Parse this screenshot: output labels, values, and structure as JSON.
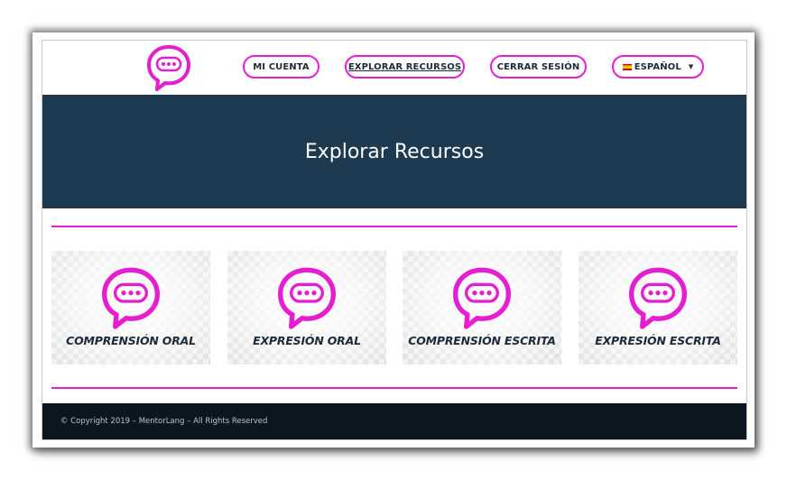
{
  "nav": {
    "my_account": "MI CUENTA",
    "explore": "EXPLORAR RECURSOS",
    "logout": "CERRAR SESIÓN",
    "language": "ESPAÑOL"
  },
  "hero": {
    "title": "Explorar Recursos"
  },
  "cards": [
    {
      "label": "COMPRENSIÓN ORAL"
    },
    {
      "label": "EXPRESIÓN ORAL"
    },
    {
      "label": "COMPRENSIÓN ESCRITA"
    },
    {
      "label": "EXPRESIÓN ESCRITA"
    }
  ],
  "footer": {
    "copyright": "© Copyright 2019 – MentorLang – All Rights Reserved"
  },
  "colors": {
    "accent": "#e61ed1",
    "hero_bg": "#1e3a50",
    "footer_bg": "#0b1720",
    "text_dark": "#1c2b3a"
  },
  "icons": {
    "logo": "speech-bubble-dots-icon",
    "card": "speech-bubble-dots-icon",
    "language_flag": "spain-flag-icon"
  }
}
